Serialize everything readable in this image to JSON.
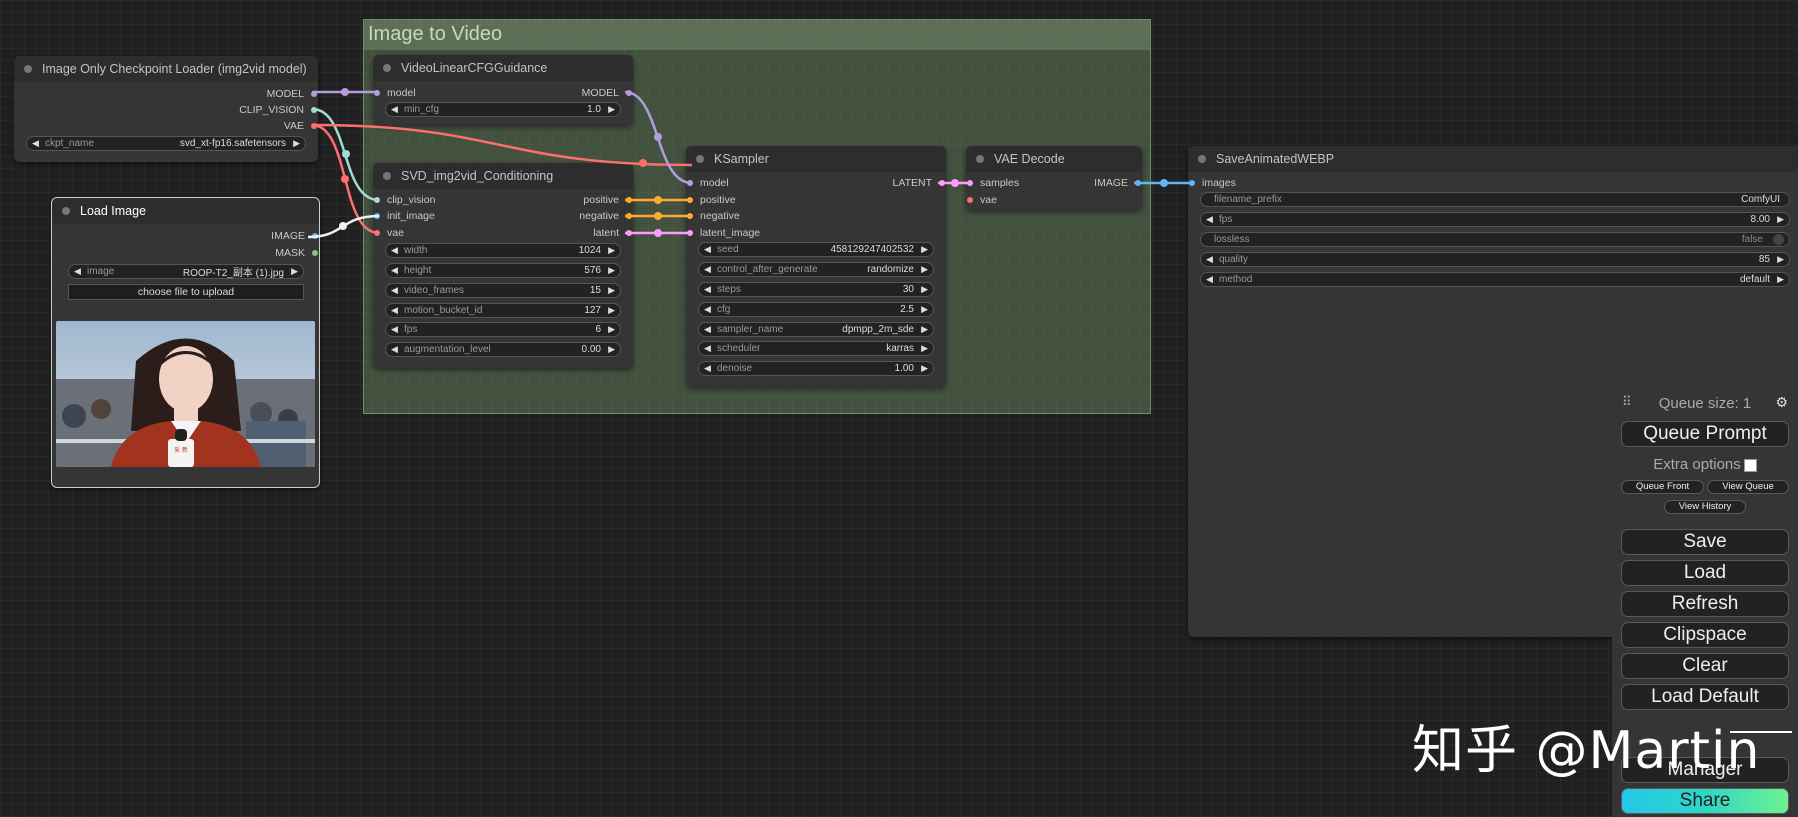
{
  "group": {
    "title": "Image to Video"
  },
  "nodes": {
    "checkpoint": {
      "title": "Image Only Checkpoint Loader (img2vid model)",
      "outputs": [
        "MODEL",
        "CLIP_VISION",
        "VAE"
      ],
      "ckpt_label": "ckpt_name",
      "ckpt_value": "svd_xt-fp16.safetensors"
    },
    "load_image": {
      "title": "Load Image",
      "outputs": [
        "IMAGE",
        "MASK"
      ],
      "image_label": "image",
      "image_value": "ROOP-T2_副本 (1).jpg",
      "upload_label": "choose file to upload",
      "mic_label": "采 新"
    },
    "cfg_guidance": {
      "title": "VideoLinearCFGGuidance",
      "input": "model",
      "output": "MODEL",
      "widget_label": "min_cfg",
      "widget_value": "1.0"
    },
    "svd": {
      "title": "SVD_img2vid_Conditioning",
      "inputs": [
        "clip_vision",
        "init_image",
        "vae"
      ],
      "outputs": [
        "positive",
        "negative",
        "latent"
      ],
      "widgets": [
        {
          "label": "width",
          "value": "1024"
        },
        {
          "label": "height",
          "value": "576"
        },
        {
          "label": "video_frames",
          "value": "15"
        },
        {
          "label": "motion_bucket_id",
          "value": "127"
        },
        {
          "label": "fps",
          "value": "6"
        },
        {
          "label": "augmentation_level",
          "value": "0.00"
        }
      ]
    },
    "ksampler": {
      "title": "KSampler",
      "inputs": [
        "model",
        "positive",
        "negative",
        "latent_image"
      ],
      "output": "LATENT",
      "widgets": [
        {
          "label": "seed",
          "value": "458129247402532"
        },
        {
          "label": "control_after_generate",
          "value": "randomize"
        },
        {
          "label": "steps",
          "value": "30"
        },
        {
          "label": "cfg",
          "value": "2.5"
        },
        {
          "label": "sampler_name",
          "value": "dpmpp_2m_sde"
        },
        {
          "label": "scheduler",
          "value": "karras"
        },
        {
          "label": "denoise",
          "value": "1.00"
        }
      ]
    },
    "vae_decode": {
      "title": "VAE Decode",
      "inputs": [
        "samples",
        "vae"
      ],
      "output": "IMAGE"
    },
    "save_webp": {
      "title": "SaveAnimatedWEBP",
      "input": "images",
      "widgets": [
        {
          "label": "filename_prefix",
          "value": "ComfyUI"
        },
        {
          "label": "fps",
          "value": "8.00"
        },
        {
          "label": "lossless",
          "value": "false"
        },
        {
          "label": "quality",
          "value": "85"
        },
        {
          "label": "method",
          "value": "default"
        }
      ]
    }
  },
  "menu": {
    "queue_size": "Queue size: 1",
    "queue_prompt": "Queue Prompt",
    "extra_options": "Extra options",
    "queue_front": "Queue Front",
    "view_queue": "View Queue",
    "view_history": "View History",
    "save": "Save",
    "load": "Load",
    "refresh": "Refresh",
    "clipspace": "Clipspace",
    "clear": "Clear",
    "load_default": "Load Default",
    "manager": "Manager",
    "share": "Share"
  },
  "watermark": "知乎 @Martin",
  "colors": {
    "model": "#b39ddb",
    "clip_vision": "#a1dbd3",
    "vae": "#ff6e6e",
    "image": "#64b5f6",
    "conditioning": "#ffa931",
    "latent": "#ff9cf9",
    "mask": "#81c784",
    "group_bg": "#6e8f69"
  }
}
